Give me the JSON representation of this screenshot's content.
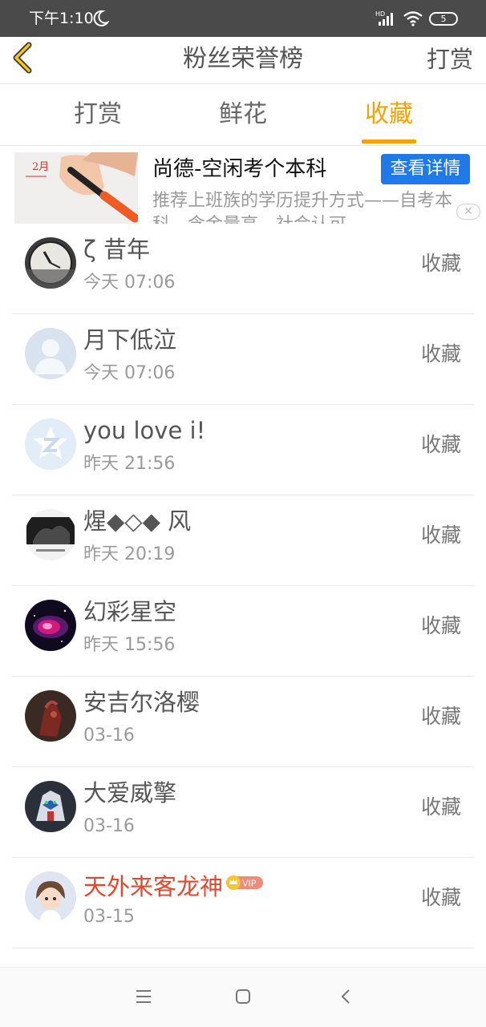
{
  "status_bar": {
    "time": "下午1:10",
    "hd_label": "HD",
    "battery": "5"
  },
  "header": {
    "title": "粉丝荣誉榜",
    "action": "打赏"
  },
  "tabs": [
    {
      "label": "打赏"
    },
    {
      "label": "鲜花"
    },
    {
      "label": "收藏"
    }
  ],
  "active_tab": "收藏",
  "ad": {
    "title": "尚德-空闲考个本科",
    "button": "查看详情",
    "description": "推荐上班族的学历提升方式——自考本科，含金量高，社会认可",
    "image_text": "2月"
  },
  "rows": [
    {
      "name": "ζ 昔年",
      "time": "今天 07:06",
      "action": "收藏"
    },
    {
      "name": "月下低泣",
      "time": "今天 07:06",
      "action": "收藏"
    },
    {
      "name": "you love i!",
      "time": "昨天 21:56",
      "action": "收藏"
    },
    {
      "name": "煋◆◇◆ 风",
      "time": "昨天 20:19",
      "action": "收藏"
    },
    {
      "name": "幻彩星空",
      "time": "昨天 15:56",
      "action": "收藏"
    },
    {
      "name": "安吉尔洛樱",
      "time": "03-16",
      "action": "收藏"
    },
    {
      "name": "大爱威擎",
      "time": "03-16",
      "action": "收藏"
    },
    {
      "name": "天外来客龙神",
      "time": "03-15",
      "action": "收藏",
      "vip": "VIP"
    }
  ],
  "colors": {
    "accent": "#f0a30a",
    "vip_name": "#e0492f",
    "ad_button": "#1f7ae8",
    "status_bar": "#4a4a4a"
  }
}
